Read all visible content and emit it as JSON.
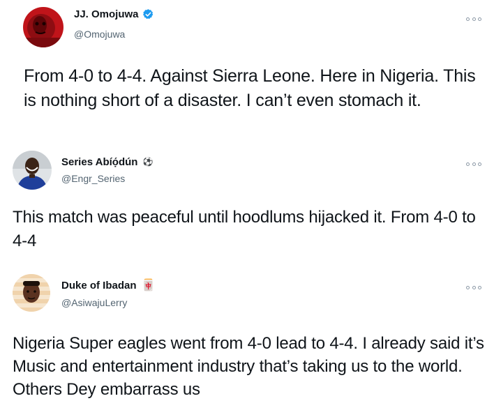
{
  "tweets": [
    {
      "display_name": "JJ. Omojuwa",
      "handle": "@Omojuwa",
      "verified": true,
      "avatar_icon": "profile-photo-red",
      "more_icon": "more-options-icon",
      "text": "From 4-0 to 4-4. Against Sierra Leone. Here in Nigeria. This is nothing short of a disaster. I can’t even stomach it."
    },
    {
      "display_name": "Series Abíọ́dún",
      "handle": "@Engr_Series",
      "name_emoji": "⚽",
      "avatar_icon": "profile-photo-blue-jersey",
      "more_icon": "more-options-icon",
      "text": "This match was peaceful until hoodlums hijacked it. From 4-0 to 4-4"
    },
    {
      "display_name": "Duke of Ibadan",
      "handle": "@AsiwajuLerry",
      "name_emoji": "🀄",
      "avatar_icon": "profile-photo-striped",
      "more_icon": "more-options-icon",
      "text": "Nigeria Super eagles went from 4-0 lead to 4-4. I already said it’s Music and entertainment industry that’s taking us to the world. Others Dey embarrass us"
    }
  ],
  "colors": {
    "text": "#0f1419",
    "secondary": "#536471",
    "verified": "#1d9bf0",
    "avatar1": "#c0141a"
  }
}
